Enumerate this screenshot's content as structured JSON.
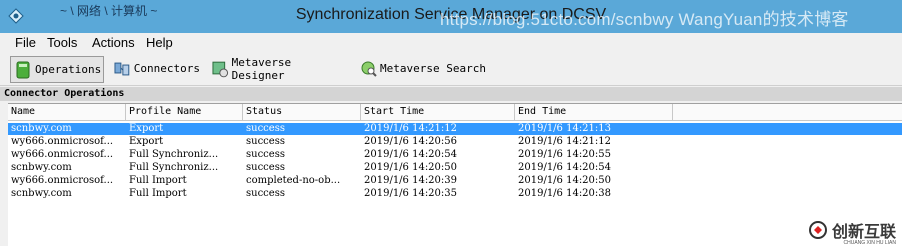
{
  "window": {
    "title": "Synchronization Service Manager on DCSV",
    "title_scribble": "~ \\ 网络 \\ 计算机 ~",
    "watermark": "https://blog.51cto.com/scnbwy WangYuan的技术博客"
  },
  "menu": [
    "File",
    "Tools",
    "Actions",
    "Help"
  ],
  "toolbar": [
    {
      "label": "Operations",
      "icon": "operations-icon",
      "active": true
    },
    {
      "label": "Connectors",
      "icon": "connectors-icon",
      "active": false
    },
    {
      "label": "Metaverse Designer",
      "icon": "metaverse-designer-icon",
      "active": false
    },
    {
      "label": "Metaverse Search",
      "icon": "metaverse-search-icon",
      "active": false
    }
  ],
  "section_title": "Connector Operations",
  "columns": [
    "Name",
    "Profile Name",
    "Status",
    "Start Time",
    "End Time"
  ],
  "rows": [
    {
      "name": "scnbwy.com",
      "profile": "Export",
      "status": "success",
      "start": "2019/1/6 14:21:12",
      "end": "2019/1/6 14:21:13",
      "selected": true
    },
    {
      "name": "wy666.onmicrosof...",
      "profile": "Export",
      "status": "success",
      "start": "2019/1/6 14:20:56",
      "end": "2019/1/6 14:21:12",
      "selected": false
    },
    {
      "name": "wy666.onmicrosof...",
      "profile": "Full Synchroniz...",
      "status": "success",
      "start": "2019/1/6 14:20:54",
      "end": "2019/1/6 14:20:55",
      "selected": false
    },
    {
      "name": "scnbwy.com",
      "profile": "Full Synchroniz...",
      "status": "success",
      "start": "2019/1/6 14:20:50",
      "end": "2019/1/6 14:20:54",
      "selected": false
    },
    {
      "name": "wy666.onmicrosof...",
      "profile": "Full Import",
      "status": "completed-no-ob...",
      "start": "2019/1/6 14:20:39",
      "end": "2019/1/6 14:20:50",
      "selected": false
    },
    {
      "name": "scnbwy.com",
      "profile": "Full Import",
      "status": "success",
      "start": "2019/1/6 14:20:35",
      "end": "2019/1/6 14:20:38",
      "selected": false
    }
  ],
  "brand": {
    "text": "创新互联",
    "sub": "CHUANG XIN HU LIAN"
  },
  "colors": {
    "titlebar": "#5aa8d8",
    "selection": "#3399ff"
  }
}
